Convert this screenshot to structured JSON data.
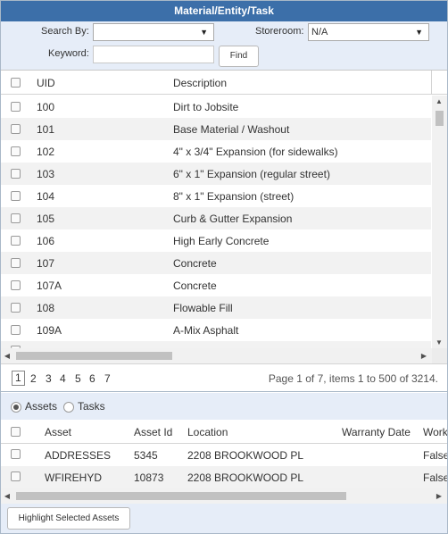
{
  "title": "Material/Entity/Task",
  "search": {
    "search_by_label": "Search By:",
    "search_by_value": "",
    "storeroom_label": "Storeroom:",
    "storeroom_value": "N/A",
    "keyword_label": "Keyword:",
    "keyword_value": "",
    "find_label": "Find"
  },
  "materials": {
    "columns": [
      "UID",
      "Description"
    ],
    "rows": [
      {
        "uid": "100",
        "description": "Dirt to Jobsite"
      },
      {
        "uid": "101",
        "description": "Base Material / Washout"
      },
      {
        "uid": "102",
        "description": "4\" x 3/4\" Expansion (for sidewalks)"
      },
      {
        "uid": "103",
        "description": "6\" x 1\" Expansion (regular street)"
      },
      {
        "uid": "104",
        "description": "8\" x 1\" Expansion (street)"
      },
      {
        "uid": "105",
        "description": "Curb & Gutter Expansion"
      },
      {
        "uid": "106",
        "description": "High Early Concrete"
      },
      {
        "uid": "107",
        "description": "Concrete"
      },
      {
        "uid": "107A",
        "description": "Concrete"
      },
      {
        "uid": "108",
        "description": "Flowable Fill"
      },
      {
        "uid": "109A",
        "description": "A-Mix Asphalt"
      }
    ]
  },
  "pager": {
    "pages": [
      "1",
      "2",
      "3",
      "4",
      "5",
      "6",
      "7"
    ],
    "current_page": "1",
    "info": "Page 1 of 7, items 1 to 500 of 3214."
  },
  "mode": {
    "assets_label": "Assets",
    "tasks_label": "Tasks",
    "selected": "Assets"
  },
  "assets": {
    "columns": [
      "Asset",
      "Asset Id",
      "Location",
      "Warranty Date",
      "Work"
    ],
    "rows": [
      {
        "asset": "ADDRESSES",
        "asset_id": "5345",
        "location": "2208 BROOKWOOD PL",
        "warranty_date": "",
        "work": "False"
      },
      {
        "asset": "WFIREHYD",
        "asset_id": "10873",
        "location": "2208 BROOKWOOD PL",
        "warranty_date": "",
        "work": "False"
      }
    ]
  },
  "footer": {
    "highlight_label": "Highlight Selected Assets"
  },
  "colors": {
    "title_bar": "#3c6fa9",
    "toolbar_bg": "#e6edf8",
    "alt_row": "#f2f2f2"
  },
  "icons": {
    "dropdown": "chevron-down-icon",
    "scroll_up": "arrow-up-icon",
    "scroll_down": "arrow-down-icon",
    "scroll_left": "arrow-left-icon",
    "scroll_right": "arrow-right-icon"
  }
}
